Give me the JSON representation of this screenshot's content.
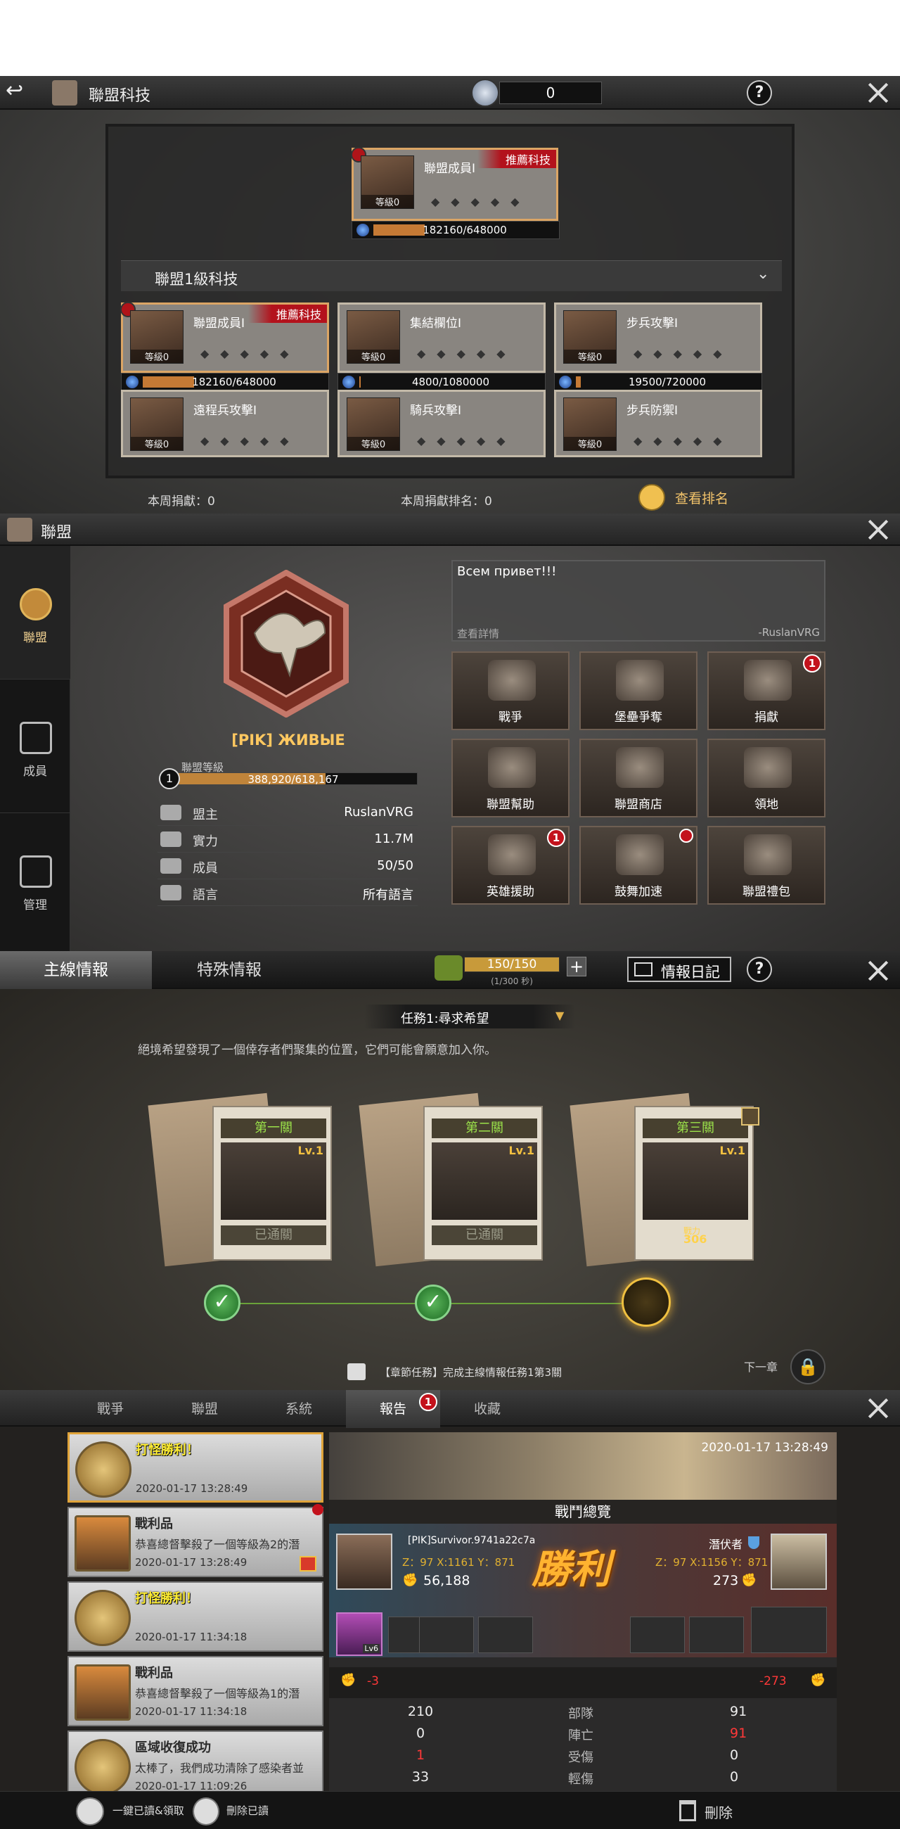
{
  "tech": {
    "title": "聯盟科技",
    "currency": "0",
    "top_card": {
      "name": "聯盟成員I",
      "tag": "推薦科技",
      "level": "等級0",
      "progress": "182160/648000",
      "fraction": 0.28
    },
    "section_title": "聯盟1級科技",
    "cards": [
      {
        "name": "聯盟成員I",
        "tag": "推薦科技",
        "level": "等級0",
        "progress": "182160/648000",
        "fraction": 0.28
      },
      {
        "name": "集結欄位I",
        "level": "等級0",
        "progress": "4800/1080000",
        "fraction": 0.0044
      },
      {
        "name": "步兵攻擊I",
        "level": "等級0",
        "progress": "19500/720000",
        "fraction": 0.027
      },
      {
        "name": "遠程兵攻擊I",
        "level": "等級0"
      },
      {
        "name": "騎兵攻擊I",
        "level": "等級0"
      },
      {
        "name": "步兵防禦I",
        "level": "等級0"
      }
    ],
    "weekly_donation": "本周捐獻：0",
    "weekly_rank": "本周捐獻排名：0",
    "view_rank": "查看排名"
  },
  "alliance": {
    "title": "聯盟",
    "sidebar": [
      "聯盟",
      "成員",
      "管理"
    ],
    "name": "[PIK] ЖИВЫЕ",
    "level_label": "聯盟等級",
    "level": "1",
    "exp": "388,920/618,167",
    "exp_fraction": 0.63,
    "info": [
      {
        "k": "盟主",
        "v": "RuslanVRG"
      },
      {
        "k": "實力",
        "v": "11.7M"
      },
      {
        "k": "成員",
        "v": "50/50"
      },
      {
        "k": "語言",
        "v": "所有語言"
      }
    ],
    "message": "Всем привет!!!",
    "details": "查看詳情",
    "author": "-RuslanVRG",
    "grid": [
      {
        "label": "戰爭"
      },
      {
        "label": "堡壘爭奪"
      },
      {
        "label": "捐獻",
        "badge": "1"
      },
      {
        "label": "聯盟幫助"
      },
      {
        "label": "聯盟商店"
      },
      {
        "label": "領地"
      },
      {
        "label": "英雄援助",
        "badge": "1"
      },
      {
        "label": "鼓舞加速",
        "dot": true
      },
      {
        "label": "聯盟禮包"
      }
    ]
  },
  "intel": {
    "tab_main": "主線情報",
    "tab_special": "特殊情報",
    "stamina": "150/150",
    "rate": "(1/300 秒)",
    "plus": "+",
    "diary": "情報日記",
    "mission": "任務1:尋求希望",
    "desc": "絕境希望發現了一個倖存者們聚集的位置，它們可能會願意加入你。",
    "stages": [
      {
        "title": "第一關",
        "lv": "Lv.1",
        "status": "已通關"
      },
      {
        "title": "第二關",
        "lv": "Lv.1",
        "status": "已通關"
      },
      {
        "title": "第三關",
        "lv": "Lv.1",
        "power_label": "戰力",
        "power": "306"
      }
    ],
    "chapter_task": "【章節任務】完成主線情報任務1第3關",
    "next": "下一章"
  },
  "mail": {
    "tabs": [
      "戰爭",
      "聯盟",
      "系統",
      "報告",
      "收藏"
    ],
    "report_badge": "1",
    "reports": [
      {
        "title": "打怪勝利！",
        "time": "2020-01-17 13:28:49",
        "type": "win"
      },
      {
        "title": "戰利品",
        "desc": "恭喜總督擊殺了一個等級為2的潛",
        "time": "2020-01-17 13:28:49",
        "type": "loot"
      },
      {
        "title": "打怪勝利！",
        "time": "2020-01-17 11:34:18",
        "type": "win"
      },
      {
        "title": "戰利品",
        "desc": "恭喜總督擊殺了一個等級為1的潛",
        "time": "2020-01-17 11:34:18",
        "type": "loot"
      },
      {
        "title": "區域收復成功",
        "desc": "太棒了，我們成功清除了感染者並",
        "time": "2020-01-17 11:09:26",
        "type": "win"
      }
    ],
    "read_all": "一鍵已讀&領取",
    "delete_read": "刪除已讀",
    "battle": {
      "banner_time": "2020-01-17 13:28:49",
      "overview": "戰鬥總覽",
      "victory": "勝利",
      "left": {
        "name": "[PIK]Survivor.9741a22c7a",
        "coords": "Z：97 X:1161 Y：871",
        "power": "56,188",
        "loss": "-3",
        "hero_lv": "Lv6"
      },
      "right": {
        "name": "潛伏者",
        "coords": "Z：97 X:1156 Y：871",
        "power": "273",
        "loss": "-273"
      },
      "stats": [
        {
          "l": "210",
          "k": "部隊",
          "r": "91"
        },
        {
          "l": "0",
          "k": "陣亡",
          "r": "91"
        },
        {
          "l": "1",
          "k": "受傷",
          "r": "0"
        },
        {
          "l": "33",
          "k": "輕傷",
          "r": "0"
        }
      ],
      "delete": "刪除"
    }
  }
}
